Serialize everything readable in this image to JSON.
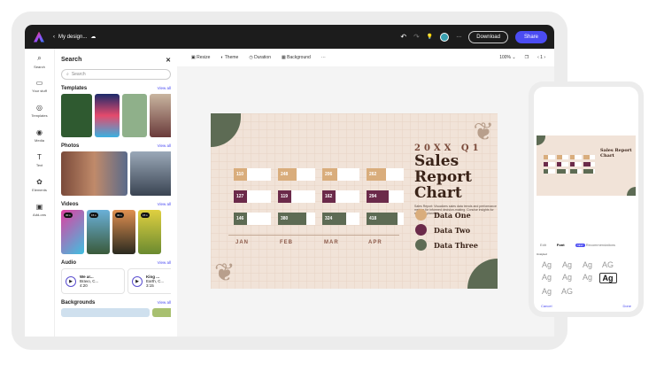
{
  "topbar": {
    "title": "My design...",
    "download": "Download",
    "share": "Share"
  },
  "rail": [
    {
      "icon": "⌕",
      "label": "Search"
    },
    {
      "icon": "▭",
      "label": "Your stuff"
    },
    {
      "icon": "◎",
      "label": "Templates"
    },
    {
      "icon": "◉",
      "label": "Media"
    },
    {
      "icon": "T",
      "label": "Text"
    },
    {
      "icon": "✿",
      "label": "Elements"
    },
    {
      "icon": "▣",
      "label": "Add-ons"
    }
  ],
  "panel": {
    "title": "Search",
    "placeholder": "Search",
    "view_all": "View all",
    "sections": {
      "templates": "Templates",
      "photos": "Photos",
      "videos": "Videos",
      "audio": "Audio",
      "backgrounds": "Backgrounds"
    },
    "videos": [
      "30 s",
      "15 s",
      "30 s",
      "15 s"
    ],
    "audio": [
      {
        "title": "We ar...",
        "artist": "Bravo, C...",
        "duration": "4:20"
      },
      {
        "title": "King ...",
        "artist": "Earth, C...",
        "duration": "3:15"
      }
    ]
  },
  "toolbar": {
    "resize": "Resize",
    "theme": "Theme",
    "duration": "Duration",
    "background": "Background",
    "more": "···",
    "zoom": "100%",
    "page": "1"
  },
  "slide": {
    "kicker": "20XX Q1",
    "title1": "Sales Report",
    "title2": "Chart",
    "desc": "Sales Report: Visualizes sales data trends and performance metrics for informed decision-making. Concise insights for strategic planning."
  },
  "chart_data": {
    "type": "bar",
    "categories": [
      "JAN",
      "FEB",
      "MAR",
      "APR"
    ],
    "max": 500,
    "series": [
      {
        "name": "Data One",
        "color": "#d9ad7c",
        "values": [
          110,
          248,
          206,
          262
        ]
      },
      {
        "name": "Data Two",
        "color": "#6b2a4a",
        "values": [
          127,
          119,
          162,
          294
        ]
      },
      {
        "name": "Data Three",
        "color": "#5d6b54",
        "values": [
          146,
          380,
          324,
          418
        ]
      }
    ]
  },
  "phone": {
    "tabs": [
      "Edit",
      "Font",
      "Recommendations"
    ],
    "new_badge": "NEW",
    "section": "Unstyled",
    "cancel": "Cancel",
    "done": "Done",
    "samples": [
      "Ag",
      "Ag",
      "Ag",
      "AG",
      "Ag",
      "Ag",
      "Ag",
      "Ag",
      "Ag",
      "AG"
    ]
  }
}
